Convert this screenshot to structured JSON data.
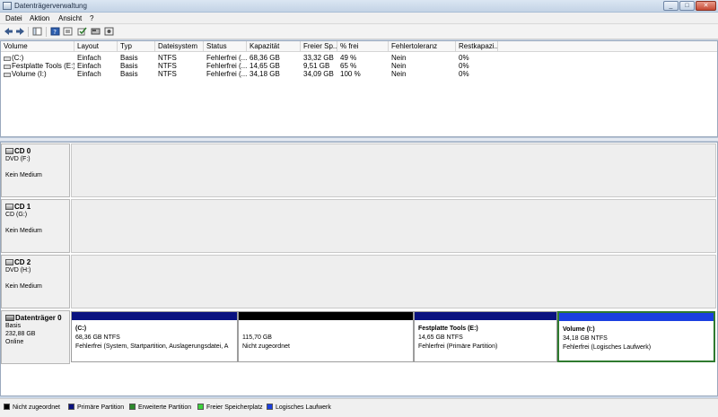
{
  "window": {
    "title": "Datenträgerverwaltung"
  },
  "menu": [
    "Datei",
    "Aktion",
    "Ansicht",
    "?"
  ],
  "volumes": {
    "columns": [
      "Volume",
      "Layout",
      "Typ",
      "Dateisystem",
      "Status",
      "Kapazität",
      "Freier Sp...",
      "% frei",
      "Fehlertoleranz",
      "Restkapazi..."
    ],
    "rows": [
      [
        "(C:)",
        "Einfach",
        "Basis",
        "NTFS",
        "Fehlerfrei (...",
        "68,36 GB",
        "33,32 GB",
        "49 %",
        "Nein",
        "0%"
      ],
      [
        "Festplatte Tools (E:)",
        "Einfach",
        "Basis",
        "NTFS",
        "Fehlerfrei (...",
        "14,65 GB",
        "9,51 GB",
        "65 %",
        "Nein",
        "0%"
      ],
      [
        "Volume (I:)",
        "Einfach",
        "Basis",
        "NTFS",
        "Fehlerfrei (...",
        "34,18 GB",
        "34,09 GB",
        "100 %",
        "Nein",
        "0%"
      ]
    ]
  },
  "disks": [
    {
      "name": "CD 0",
      "lines": [
        "DVD (F:)",
        "",
        "Kein Medium"
      ]
    },
    {
      "name": "CD 1",
      "lines": [
        "CD (G:)",
        "",
        "Kein Medium"
      ]
    },
    {
      "name": "CD 2",
      "lines": [
        "DVD (H:)",
        "",
        "Kein Medium"
      ]
    },
    {
      "name": "Datenträger 0",
      "lines": [
        "Basis",
        "232,88 GB",
        "Online"
      ]
    }
  ],
  "partitions": [
    {
      "name": "(C:)",
      "size": "68,36 GB NTFS",
      "status": "Fehlerfrei (System, Startpartition, Auslagerungsdatei, A",
      "bar_color": "#0a1280"
    },
    {
      "name": "",
      "size": "115,70 GB",
      "status": "Nicht zugeordnet",
      "bar_color": "#000000"
    },
    {
      "name": "Festplatte Tools  (E:)",
      "size": "14,65 GB NTFS",
      "status": "Fehlerfrei (Primäre Partition)",
      "bar_color": "#0a1280"
    },
    {
      "name": "Volume  (I:)",
      "size": "34,18 GB NTFS",
      "status": "Fehlerfrei (Logisches Laufwerk)",
      "bar_color": "#1a3fe0",
      "selected": true,
      "border_color": "#2f7a2f"
    }
  ],
  "legend": [
    {
      "label": "Nicht zugeordnet",
      "color": "#000000"
    },
    {
      "label": "Primäre Partition",
      "color": "#0a1280"
    },
    {
      "label": "Erweiterte Partition",
      "color": "#2c8a2c"
    },
    {
      "label": "Freier Speicherplatz",
      "color": "#3cd23c"
    },
    {
      "label": "Logisches Laufwerk",
      "color": "#1a3fe0"
    }
  ]
}
